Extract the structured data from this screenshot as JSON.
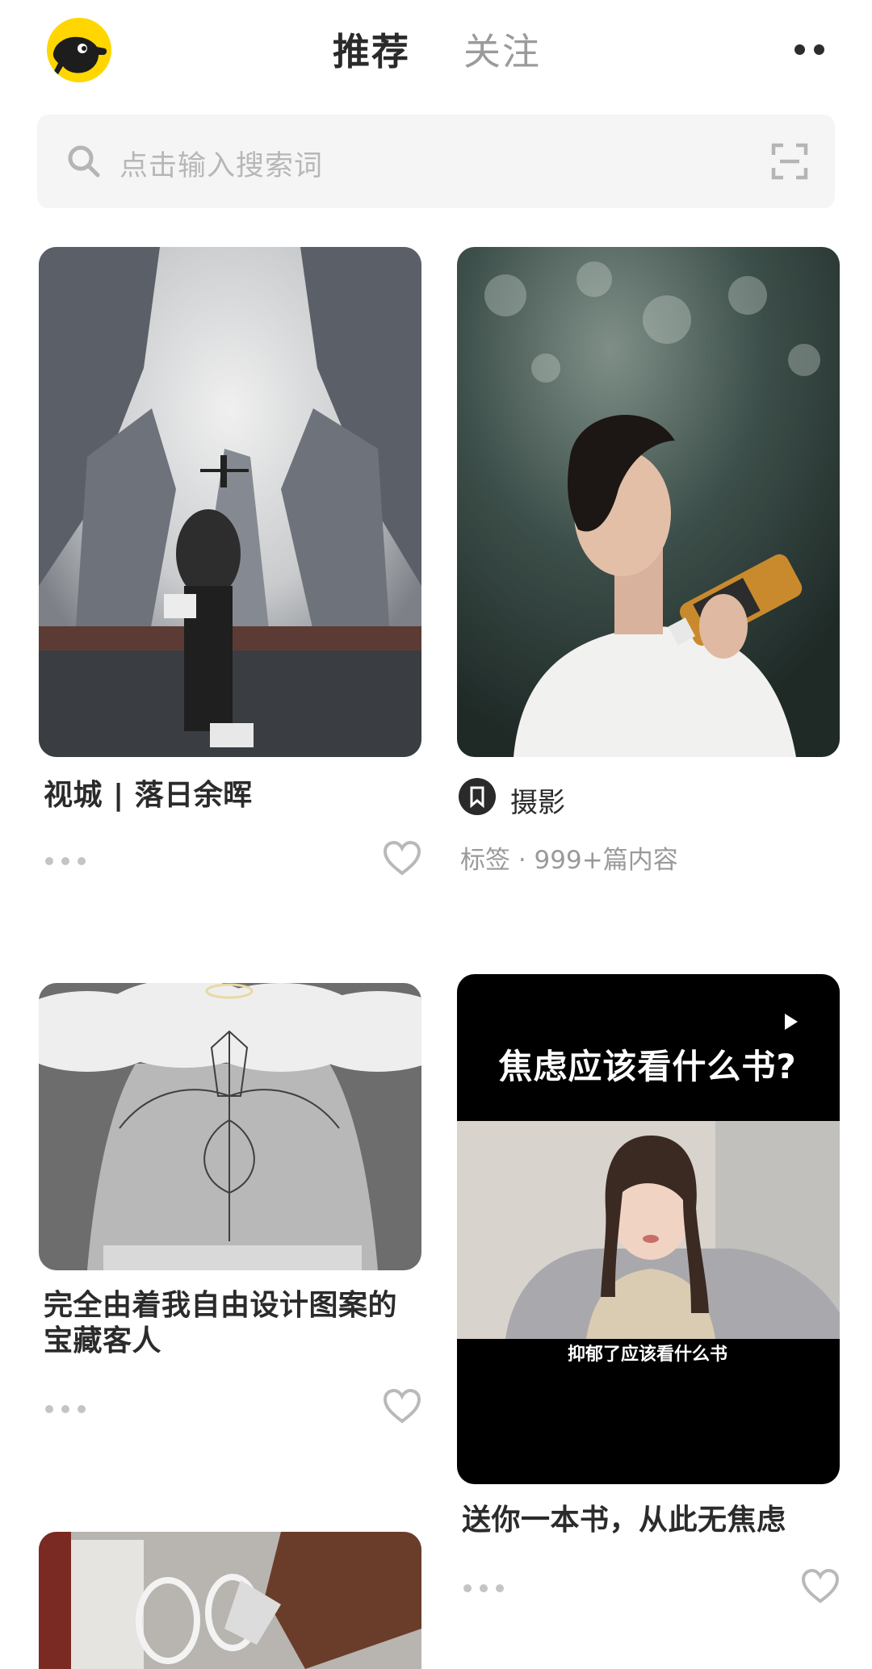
{
  "header": {
    "tabs": [
      {
        "label": "推荐",
        "active": true
      },
      {
        "label": "关注",
        "active": false
      }
    ]
  },
  "search": {
    "placeholder": "点击输入搜索词"
  },
  "cards": [
    {
      "type": "post",
      "title": "视城 | 落日余晖"
    },
    {
      "type": "tag",
      "tag_name": "摄影",
      "tag_meta": "标签 · 999+篇内容"
    },
    {
      "type": "post",
      "title_lines": [
        "完全由着我自由设计图案的",
        "宝藏客人"
      ]
    },
    {
      "type": "video",
      "overlay_title": "焦虑应该看什么书?",
      "caption": "抑郁了应该看什么书",
      "title": "送你一本书，从此无焦虑"
    },
    {
      "type": "post",
      "title": ""
    }
  ],
  "colors": {
    "brand_yellow": "#ffd600",
    "text_primary": "#2b2b2b",
    "text_secondary": "#9a9a9a",
    "search_bg": "#f5f5f5"
  }
}
